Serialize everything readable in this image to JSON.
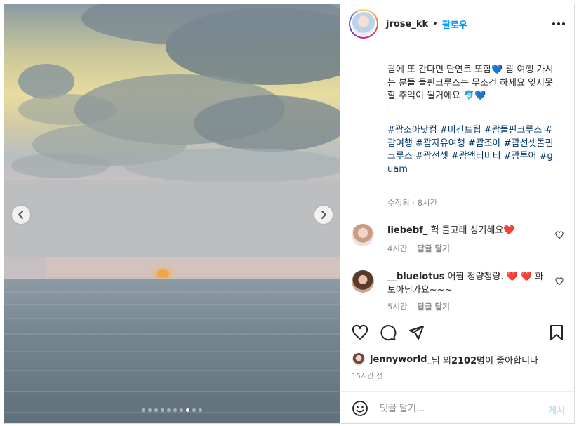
{
  "header": {
    "username": "jrose_kk",
    "separator": "•",
    "follow_label": "팔로우"
  },
  "caption": {
    "text": "괌에 또 간다면 단연코 또함💙 괌 여행 가시는 분들 돌핀크루즈는 무조건 하세요 잊지못할 추억이 될거에요 🐬💙",
    "dash": "-",
    "hashtags": "#괌조아닷컴 #비긴트립 #괌돌핀크루즈 #괌여행 #괌자유여행 #괌조아 #괌선셋돌핀크루즈 #괌선셋 #괌액티비티 #괌투어 #guam",
    "edited": "수정됨",
    "meta_sep": " · ",
    "time": "8시간"
  },
  "comments": [
    {
      "username": "liebebf_",
      "text": "헉 돌고래 싱기해요❤️",
      "time": "4시간",
      "reply_label": "답글 달기"
    },
    {
      "username": "__bluelotus",
      "text": "어쩜 청량청량..❤️ ❤️ 화보아닌가요~~~",
      "time": "5시간",
      "reply_label": "답글 달기"
    }
  ],
  "likes": {
    "liker": "jennyworld_",
    "suffix_1": "님 외 ",
    "count": "2102명",
    "suffix_2": "이 좋아합니다"
  },
  "post_time": "15시간 전",
  "add_comment": {
    "placeholder": "댓글 달기...",
    "post_label": "게시"
  },
  "carousel": {
    "total_slides": 10,
    "active_slide": 8
  },
  "colors": {
    "accent": "#0095f6",
    "hashtag": "#00376b",
    "muted": "#8e8e8e",
    "like_heart": "#ed4956"
  }
}
